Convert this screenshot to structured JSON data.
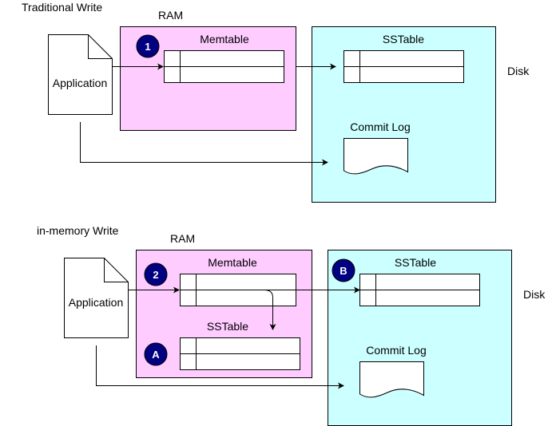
{
  "colors": {
    "ram_fill": "#ffccff",
    "disk_fill": "#ccffff",
    "badge_fill": "#000080",
    "stroke": "#000000"
  },
  "traditional": {
    "title": "Traditional Write",
    "ram_label": "RAM",
    "disk_label": "Disk",
    "application_label": "Application",
    "memtable_label": "Memtable",
    "sstable_label": "SSTable",
    "commit_log_label": "Commit Log",
    "step_badge": "1"
  },
  "in_memory": {
    "title": "in-memory Write",
    "ram_label": "RAM",
    "disk_label": "Disk",
    "application_label": "Application",
    "memtable_label": "Memtable",
    "ram_sstable_label": "SSTable",
    "disk_sstable_label": "SSTable",
    "commit_log_label": "Commit Log",
    "step_badge": "2",
    "ram_sstable_badge": "A",
    "disk_sstable_badge": "B"
  }
}
